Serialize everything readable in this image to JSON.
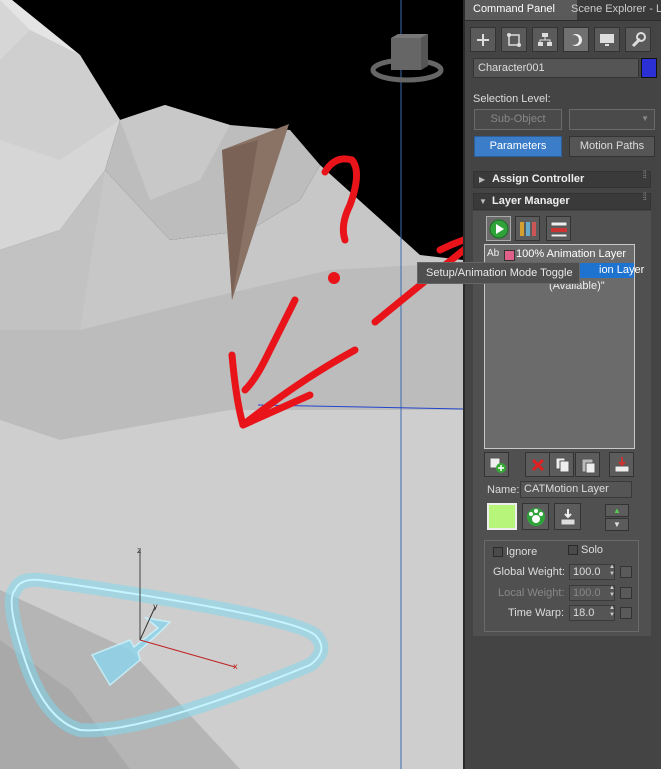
{
  "tabs": [
    {
      "label": "Command Panel",
      "active": true
    },
    {
      "label": "Scene Explorer - L",
      "active": false
    }
  ],
  "command_panel_icons": [
    "create-icon",
    "modify-icon",
    "hierarchy-icon",
    "motion-icon",
    "display-icon",
    "utilities-icon"
  ],
  "object": {
    "name": "Character001",
    "color": "#2b2fd6"
  },
  "selection_level": {
    "label": "Selection Level:",
    "sub_object": "Sub-Object",
    "parameters": "Parameters",
    "motion_paths": "Motion Paths"
  },
  "rollouts": {
    "assign_controller": "Assign Controller",
    "layer_manager": "Layer Manager"
  },
  "layer_list": {
    "items": [
      {
        "prefix": "Ab",
        "text": "100% Animation Layer"
      },
      {
        "text": "ion Layer"
      },
      {
        "text": "(Available)\""
      }
    ]
  },
  "layer_name": {
    "label": "Name:",
    "value": "CATMotion Layer"
  },
  "ignore_label": "Ignore",
  "solo_label": "Solo",
  "global_weight": {
    "label": "Global Weight:",
    "value": "100.0"
  },
  "local_weight": {
    "label": "Local Weight:",
    "value": "100.0"
  },
  "time_warp": {
    "label": "Time Warp:",
    "value": "18.0"
  },
  "tooltip": "Setup/Animation Mode Toggle",
  "viewport": {
    "gizmo_axes": [
      "z",
      "y",
      "x"
    ],
    "annotation": "?"
  }
}
